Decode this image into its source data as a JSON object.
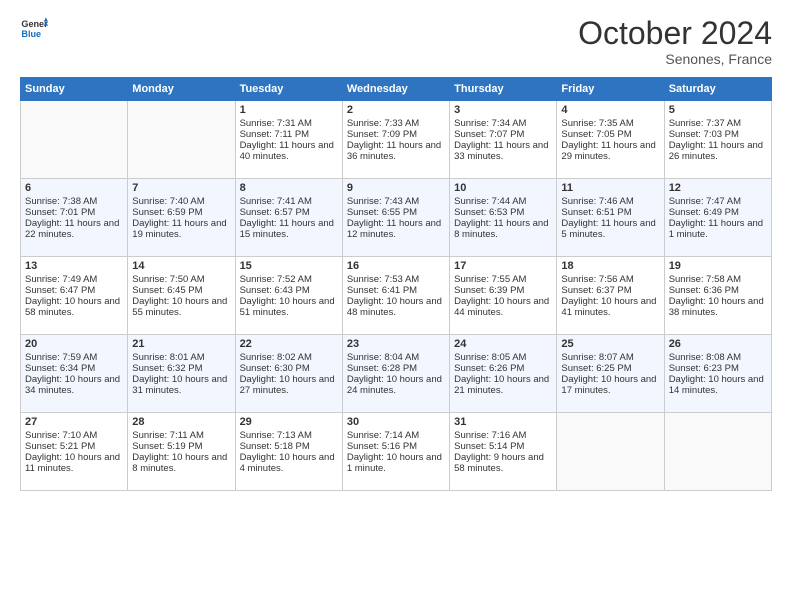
{
  "header": {
    "logo_line1": "General",
    "logo_line2": "Blue",
    "month": "October 2024",
    "location": "Senones, France"
  },
  "weekdays": [
    "Sunday",
    "Monday",
    "Tuesday",
    "Wednesday",
    "Thursday",
    "Friday",
    "Saturday"
  ],
  "weeks": [
    [
      {
        "day": "",
        "sunrise": "",
        "sunset": "",
        "daylight": ""
      },
      {
        "day": "",
        "sunrise": "",
        "sunset": "",
        "daylight": ""
      },
      {
        "day": "1",
        "sunrise": "Sunrise: 7:31 AM",
        "sunset": "Sunset: 7:11 PM",
        "daylight": "Daylight: 11 hours and 40 minutes."
      },
      {
        "day": "2",
        "sunrise": "Sunrise: 7:33 AM",
        "sunset": "Sunset: 7:09 PM",
        "daylight": "Daylight: 11 hours and 36 minutes."
      },
      {
        "day": "3",
        "sunrise": "Sunrise: 7:34 AM",
        "sunset": "Sunset: 7:07 PM",
        "daylight": "Daylight: 11 hours and 33 minutes."
      },
      {
        "day": "4",
        "sunrise": "Sunrise: 7:35 AM",
        "sunset": "Sunset: 7:05 PM",
        "daylight": "Daylight: 11 hours and 29 minutes."
      },
      {
        "day": "5",
        "sunrise": "Sunrise: 7:37 AM",
        "sunset": "Sunset: 7:03 PM",
        "daylight": "Daylight: 11 hours and 26 minutes."
      }
    ],
    [
      {
        "day": "6",
        "sunrise": "Sunrise: 7:38 AM",
        "sunset": "Sunset: 7:01 PM",
        "daylight": "Daylight: 11 hours and 22 minutes."
      },
      {
        "day": "7",
        "sunrise": "Sunrise: 7:40 AM",
        "sunset": "Sunset: 6:59 PM",
        "daylight": "Daylight: 11 hours and 19 minutes."
      },
      {
        "day": "8",
        "sunrise": "Sunrise: 7:41 AM",
        "sunset": "Sunset: 6:57 PM",
        "daylight": "Daylight: 11 hours and 15 minutes."
      },
      {
        "day": "9",
        "sunrise": "Sunrise: 7:43 AM",
        "sunset": "Sunset: 6:55 PM",
        "daylight": "Daylight: 11 hours and 12 minutes."
      },
      {
        "day": "10",
        "sunrise": "Sunrise: 7:44 AM",
        "sunset": "Sunset: 6:53 PM",
        "daylight": "Daylight: 11 hours and 8 minutes."
      },
      {
        "day": "11",
        "sunrise": "Sunrise: 7:46 AM",
        "sunset": "Sunset: 6:51 PM",
        "daylight": "Daylight: 11 hours and 5 minutes."
      },
      {
        "day": "12",
        "sunrise": "Sunrise: 7:47 AM",
        "sunset": "Sunset: 6:49 PM",
        "daylight": "Daylight: 11 hours and 1 minute."
      }
    ],
    [
      {
        "day": "13",
        "sunrise": "Sunrise: 7:49 AM",
        "sunset": "Sunset: 6:47 PM",
        "daylight": "Daylight: 10 hours and 58 minutes."
      },
      {
        "day": "14",
        "sunrise": "Sunrise: 7:50 AM",
        "sunset": "Sunset: 6:45 PM",
        "daylight": "Daylight: 10 hours and 55 minutes."
      },
      {
        "day": "15",
        "sunrise": "Sunrise: 7:52 AM",
        "sunset": "Sunset: 6:43 PM",
        "daylight": "Daylight: 10 hours and 51 minutes."
      },
      {
        "day": "16",
        "sunrise": "Sunrise: 7:53 AM",
        "sunset": "Sunset: 6:41 PM",
        "daylight": "Daylight: 10 hours and 48 minutes."
      },
      {
        "day": "17",
        "sunrise": "Sunrise: 7:55 AM",
        "sunset": "Sunset: 6:39 PM",
        "daylight": "Daylight: 10 hours and 44 minutes."
      },
      {
        "day": "18",
        "sunrise": "Sunrise: 7:56 AM",
        "sunset": "Sunset: 6:37 PM",
        "daylight": "Daylight: 10 hours and 41 minutes."
      },
      {
        "day": "19",
        "sunrise": "Sunrise: 7:58 AM",
        "sunset": "Sunset: 6:36 PM",
        "daylight": "Daylight: 10 hours and 38 minutes."
      }
    ],
    [
      {
        "day": "20",
        "sunrise": "Sunrise: 7:59 AM",
        "sunset": "Sunset: 6:34 PM",
        "daylight": "Daylight: 10 hours and 34 minutes."
      },
      {
        "day": "21",
        "sunrise": "Sunrise: 8:01 AM",
        "sunset": "Sunset: 6:32 PM",
        "daylight": "Daylight: 10 hours and 31 minutes."
      },
      {
        "day": "22",
        "sunrise": "Sunrise: 8:02 AM",
        "sunset": "Sunset: 6:30 PM",
        "daylight": "Daylight: 10 hours and 27 minutes."
      },
      {
        "day": "23",
        "sunrise": "Sunrise: 8:04 AM",
        "sunset": "Sunset: 6:28 PM",
        "daylight": "Daylight: 10 hours and 24 minutes."
      },
      {
        "day": "24",
        "sunrise": "Sunrise: 8:05 AM",
        "sunset": "Sunset: 6:26 PM",
        "daylight": "Daylight: 10 hours and 21 minutes."
      },
      {
        "day": "25",
        "sunrise": "Sunrise: 8:07 AM",
        "sunset": "Sunset: 6:25 PM",
        "daylight": "Daylight: 10 hours and 17 minutes."
      },
      {
        "day": "26",
        "sunrise": "Sunrise: 8:08 AM",
        "sunset": "Sunset: 6:23 PM",
        "daylight": "Daylight: 10 hours and 14 minutes."
      }
    ],
    [
      {
        "day": "27",
        "sunrise": "Sunrise: 7:10 AM",
        "sunset": "Sunset: 5:21 PM",
        "daylight": "Daylight: 10 hours and 11 minutes."
      },
      {
        "day": "28",
        "sunrise": "Sunrise: 7:11 AM",
        "sunset": "Sunset: 5:19 PM",
        "daylight": "Daylight: 10 hours and 8 minutes."
      },
      {
        "day": "29",
        "sunrise": "Sunrise: 7:13 AM",
        "sunset": "Sunset: 5:18 PM",
        "daylight": "Daylight: 10 hours and 4 minutes."
      },
      {
        "day": "30",
        "sunrise": "Sunrise: 7:14 AM",
        "sunset": "Sunset: 5:16 PM",
        "daylight": "Daylight: 10 hours and 1 minute."
      },
      {
        "day": "31",
        "sunrise": "Sunrise: 7:16 AM",
        "sunset": "Sunset: 5:14 PM",
        "daylight": "Daylight: 9 hours and 58 minutes."
      },
      {
        "day": "",
        "sunrise": "",
        "sunset": "",
        "daylight": ""
      },
      {
        "day": "",
        "sunrise": "",
        "sunset": "",
        "daylight": ""
      }
    ]
  ]
}
